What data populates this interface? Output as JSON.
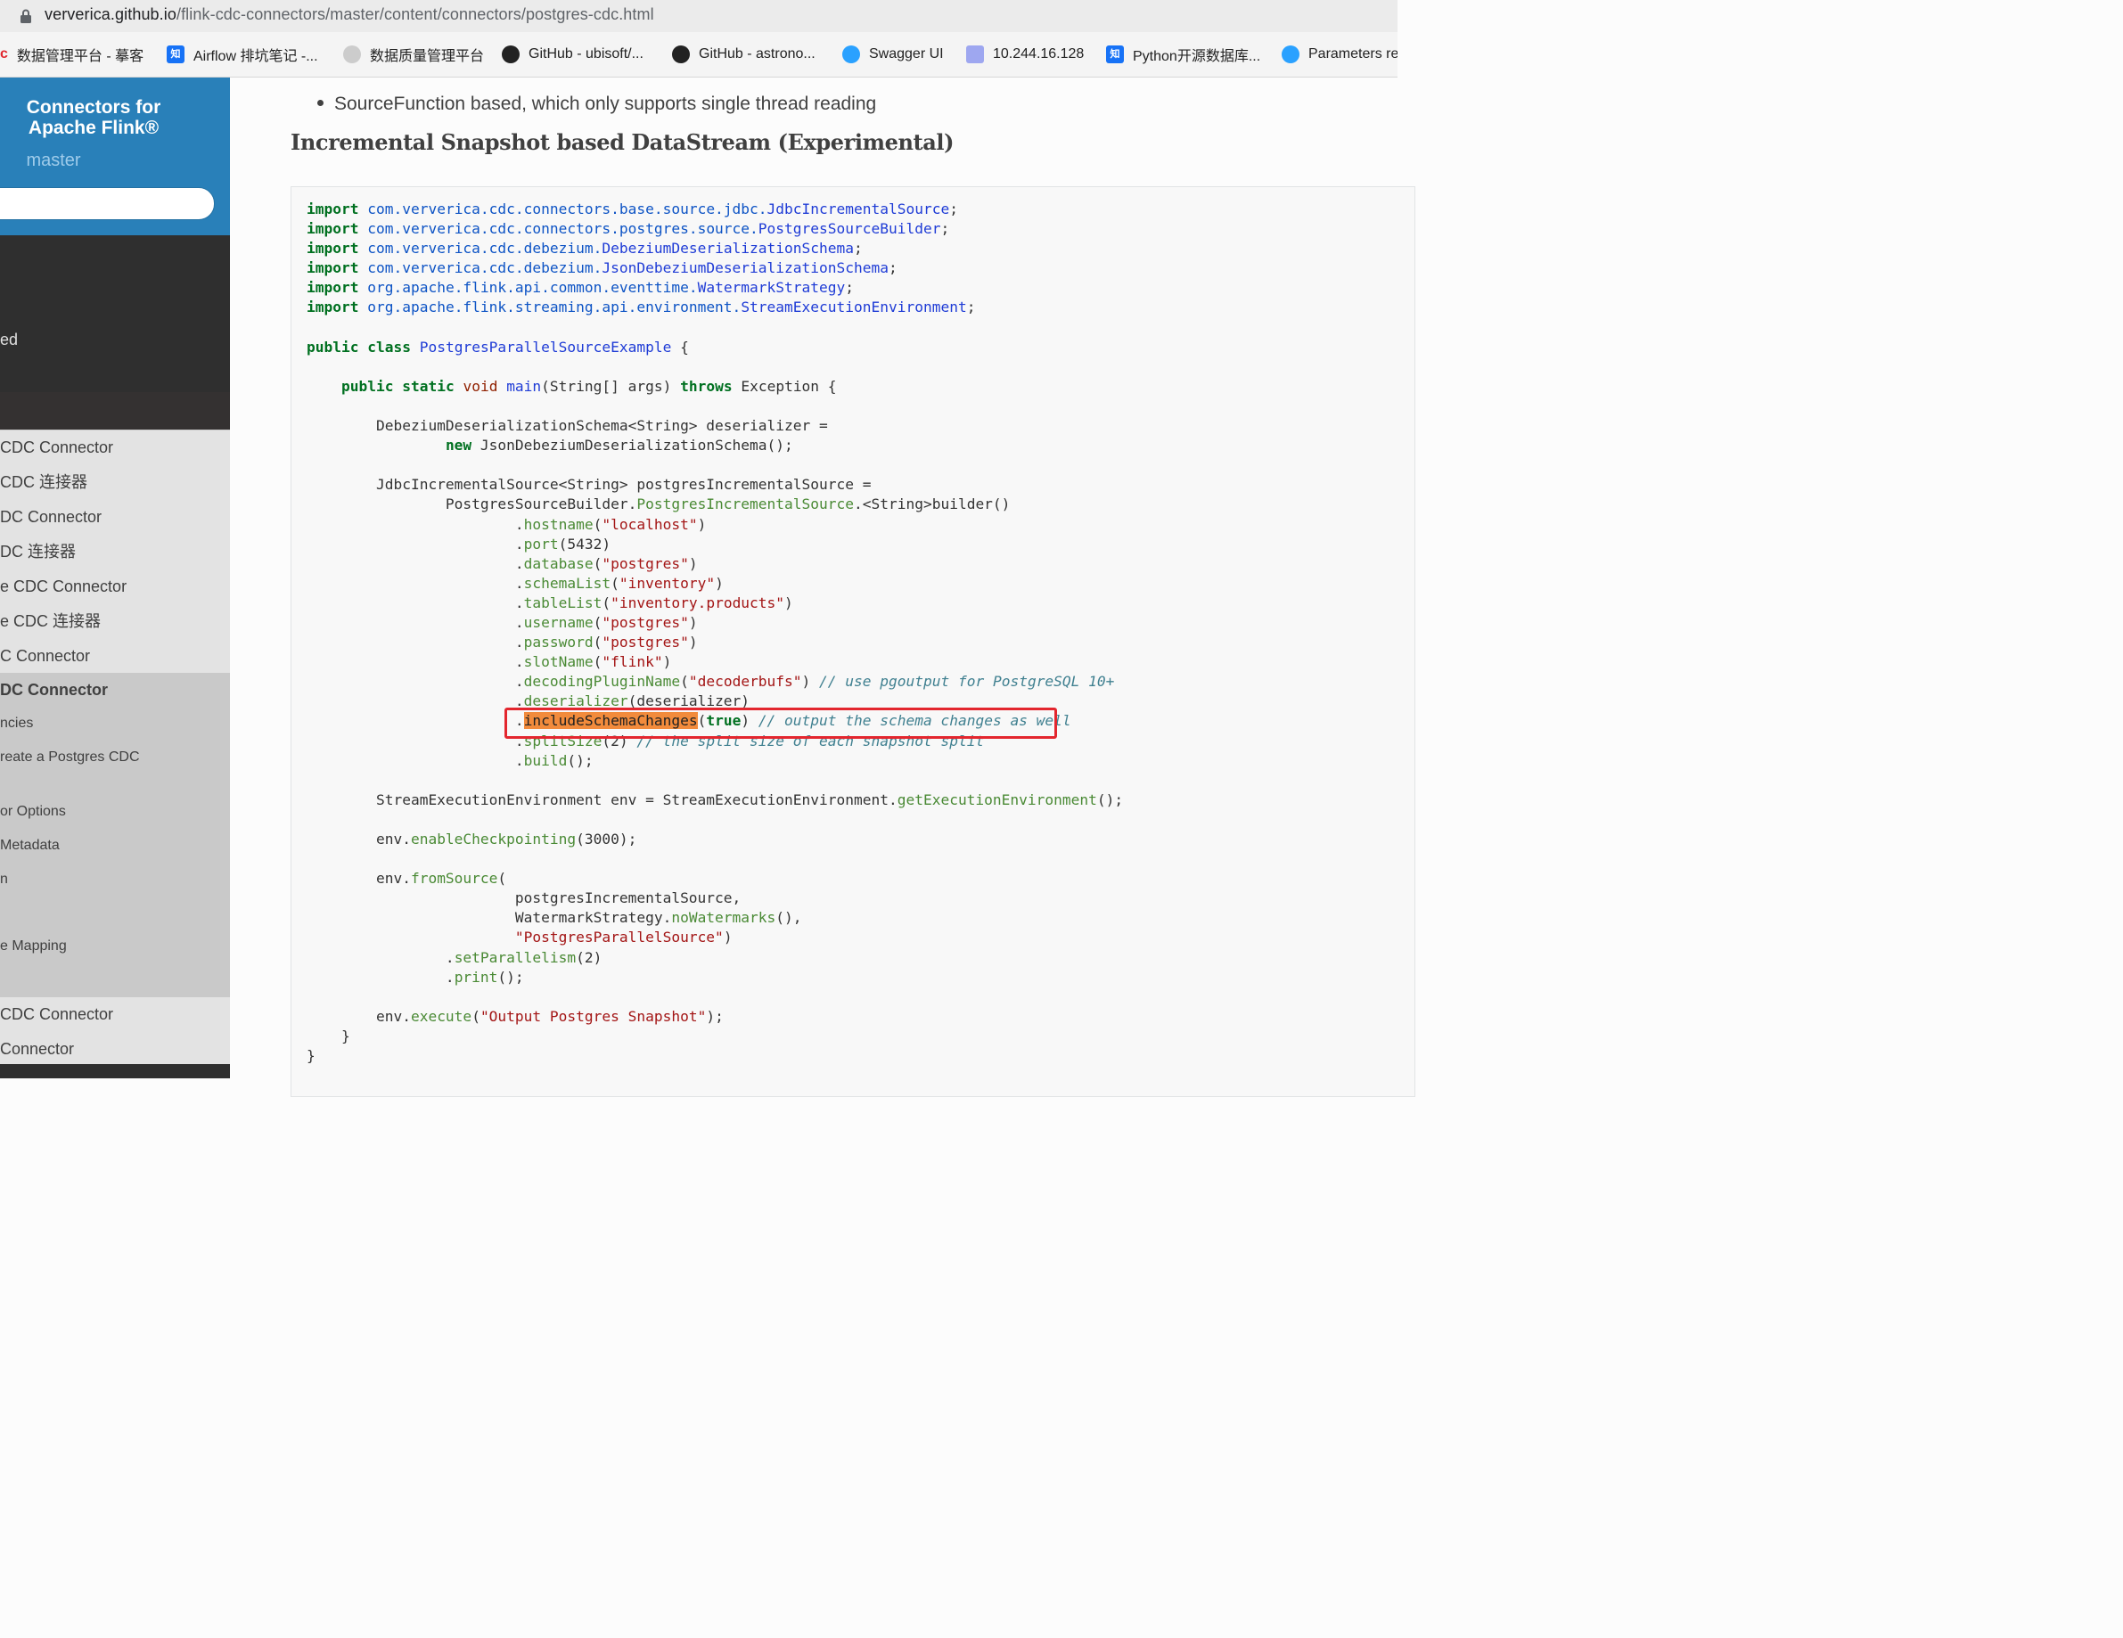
{
  "browser": {
    "url_host": "ververica.github.io",
    "url_path": "/flink-cdc-connectors/master/content/connectors/postgres-cdc.html",
    "bookmarks": [
      {
        "label": "数据管理平台 - 摹客",
        "icon": "c-icon"
      },
      {
        "label": "Airflow 排坑笔记 -...",
        "icon": "zhihu-icon"
      },
      {
        "label": "数据质量管理平台",
        "icon": "ghost-icon"
      },
      {
        "label": "GitHub - ubisoft/...",
        "icon": "github-icon"
      },
      {
        "label": "GitHub - astrono...",
        "icon": "github-icon"
      },
      {
        "label": "Swagger UI",
        "icon": "pinwheel-icon"
      },
      {
        "label": "10.244.16.128",
        "icon": "database-icon"
      },
      {
        "label": "Python开源数据库...",
        "icon": "zhihu-icon"
      },
      {
        "label": "Parameters re",
        "icon": "pinwheel-icon"
      }
    ]
  },
  "sidebar": {
    "title": "Connectors for Apache Flink®",
    "version": "master",
    "dark_item": "ed",
    "items": [
      "CDC Connector",
      "CDC 连接器",
      "DC Connector",
      "DC 连接器",
      "e CDC Connector",
      "e CDC 连接器",
      "C Connector",
      "DC Connector"
    ],
    "sub_items": [
      "ncies",
      "reate a Postgres CDC",
      "or Options",
      " Metadata",
      "n",
      "e Mapping"
    ],
    "bottom_items": [
      " CDC Connector",
      "Connector"
    ]
  },
  "content": {
    "bullet": "SourceFunction based, which only supports single thread reading",
    "heading": "Incremental Snapshot based DataStream (Experimental)"
  },
  "colors": {
    "sidebar_blue": "#2980b9",
    "highlight_red": "#e3262e",
    "highlight_orange": "#f28b3c"
  }
}
